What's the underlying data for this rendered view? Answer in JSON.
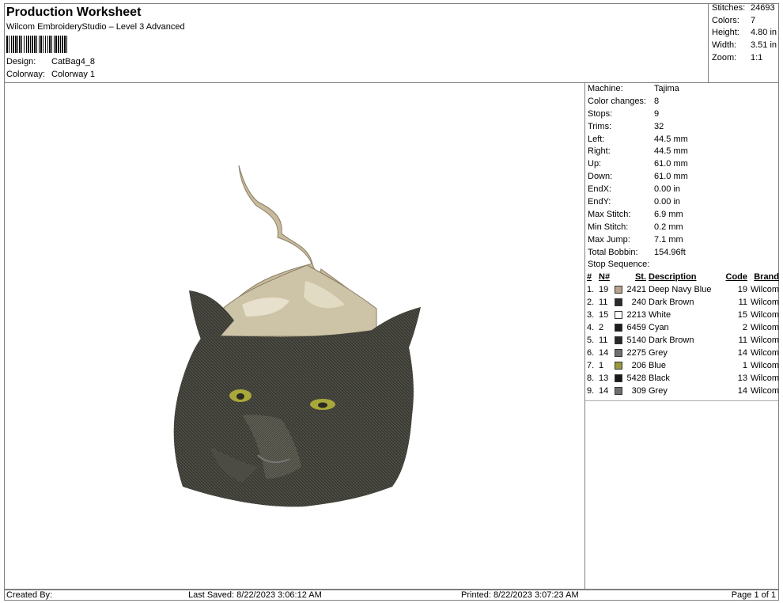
{
  "header": {
    "title": "Production Worksheet",
    "subtitle": "Wilcom EmbroideryStudio – Level 3 Advanced",
    "design_label": "Design:",
    "design_value": "CatBag4_8",
    "colorway_label": "Colorway:",
    "colorway_value": "Colorway 1"
  },
  "stats": [
    {
      "label": "Stitches:",
      "value": "24693"
    },
    {
      "label": "Colors:",
      "value": "7"
    },
    {
      "label": "Height:",
      "value": "4.80 in"
    },
    {
      "label": "Width:",
      "value": "3.51 in"
    },
    {
      "label": "Zoom:",
      "value": "1:1"
    }
  ],
  "machine_info": [
    {
      "label": "Machine:",
      "value": "Tajima"
    },
    {
      "label": "Color changes:",
      "value": "8"
    },
    {
      "label": "Stops:",
      "value": "9"
    },
    {
      "label": "Trims:",
      "value": "32"
    },
    {
      "label": "Left:",
      "value": "44.5 mm"
    },
    {
      "label": "Right:",
      "value": "44.5 mm"
    },
    {
      "label": "Up:",
      "value": "61.0 mm"
    },
    {
      "label": "Down:",
      "value": "61.0 mm"
    },
    {
      "label": "EndX:",
      "value": "0.00 in"
    },
    {
      "label": "EndY:",
      "value": "0.00 in"
    },
    {
      "label": "Max Stitch:",
      "value": "6.9 mm"
    },
    {
      "label": "Min Stitch:",
      "value": "0.2 mm"
    },
    {
      "label": "Max Jump:",
      "value": "7.1 mm"
    },
    {
      "label": "Total Bobbin:",
      "value": "154.96ft"
    }
  ],
  "stop_sequence": {
    "title": "Stop Sequence:",
    "headers": {
      "num": "#",
      "n": "N#",
      "st": "St.",
      "desc": "Description",
      "code": "Code",
      "brand": "Brand"
    },
    "rows": [
      {
        "num": "1.",
        "n": "19",
        "color": "#b8a48c",
        "st": "2421",
        "desc": "Deep Navy Blue",
        "code": "19",
        "brand": "Wilcom"
      },
      {
        "num": "2.",
        "n": "11",
        "color": "#2b2b2b",
        "st": "240",
        "desc": "Dark Brown",
        "code": "11",
        "brand": "Wilcom"
      },
      {
        "num": "3.",
        "n": "15",
        "color": "#ffffff",
        "st": "2213",
        "desc": "White",
        "code": "15",
        "brand": "Wilcom"
      },
      {
        "num": "4.",
        "n": "2",
        "color": "#1e1e1e",
        "st": "6459",
        "desc": "Cyan",
        "code": "2",
        "brand": "Wilcom"
      },
      {
        "num": "5.",
        "n": "11",
        "color": "#2b2b2b",
        "st": "5140",
        "desc": "Dark Brown",
        "code": "11",
        "brand": "Wilcom"
      },
      {
        "num": "6.",
        "n": "14",
        "color": "#6e6e6e",
        "st": "2275",
        "desc": "Grey",
        "code": "14",
        "brand": "Wilcom"
      },
      {
        "num": "7.",
        "n": "1",
        "color": "#9a9a3a",
        "st": "206",
        "desc": "Blue",
        "code": "1",
        "brand": "Wilcom"
      },
      {
        "num": "8.",
        "n": "13",
        "color": "#1a1a1a",
        "st": "5428",
        "desc": "Black",
        "code": "13",
        "brand": "Wilcom"
      },
      {
        "num": "9.",
        "n": "14",
        "color": "#6e6e6e",
        "st": "309",
        "desc": "Grey",
        "code": "14",
        "brand": "Wilcom"
      }
    ]
  },
  "footer": {
    "created_by": "Created By:",
    "last_saved": "Last Saved: 8/22/2023 3:06:12 AM",
    "printed": "Printed: 8/22/2023 3:07:23 AM",
    "page": "Page 1 of 1"
  }
}
